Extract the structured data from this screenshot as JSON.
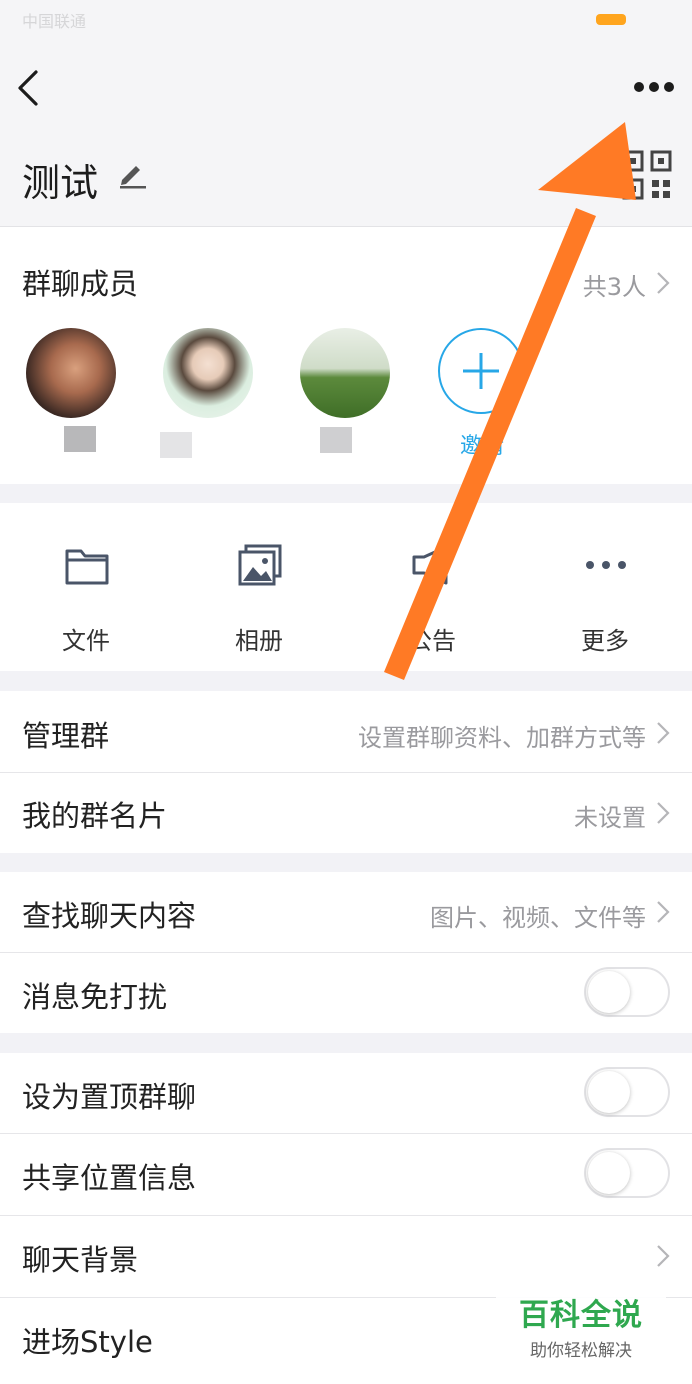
{
  "status_bar": {
    "carrier": "中国联通",
    "battery_color": "#ffa51e"
  },
  "header": {
    "group_title": "测试",
    "back_icon": "chevron-left-icon",
    "more_icon": "more-horizontal-icon",
    "edit_icon": "pencil-icon",
    "qr_icon": "qr-code-icon"
  },
  "members": {
    "label": "群聊成员",
    "count_label": "共3人",
    "invite_label": "邀请"
  },
  "tools": [
    {
      "label": "文件",
      "icon": "folder-icon"
    },
    {
      "label": "相册",
      "icon": "photo-album-icon"
    },
    {
      "label": "公告",
      "icon": "announcement-icon"
    },
    {
      "label": "更多",
      "icon": "more-dots-icon"
    }
  ],
  "settings": {
    "manage_group": {
      "label": "管理群",
      "value": "设置群聊资料、加群方式等"
    },
    "my_group_card": {
      "label": "我的群名片",
      "value": "未设置"
    },
    "search_chat": {
      "label": "查找聊天内容",
      "value": "图片、视频、文件等"
    },
    "do_not_disturb": {
      "label": "消息免打扰",
      "on": false
    },
    "pin_chat": {
      "label": "设为置顶群聊",
      "on": false
    },
    "share_location": {
      "label": "共享位置信息",
      "on": false
    },
    "chat_background": {
      "label": "聊天背景"
    },
    "entrance_style": {
      "label": "进场Style"
    }
  },
  "watermark": {
    "title": "百科全说",
    "subtitle": "助你轻松解决"
  },
  "colors": {
    "accent": "#27a7e7",
    "arrow": "#ff7a25",
    "watermark_green": "#2fa84f"
  }
}
